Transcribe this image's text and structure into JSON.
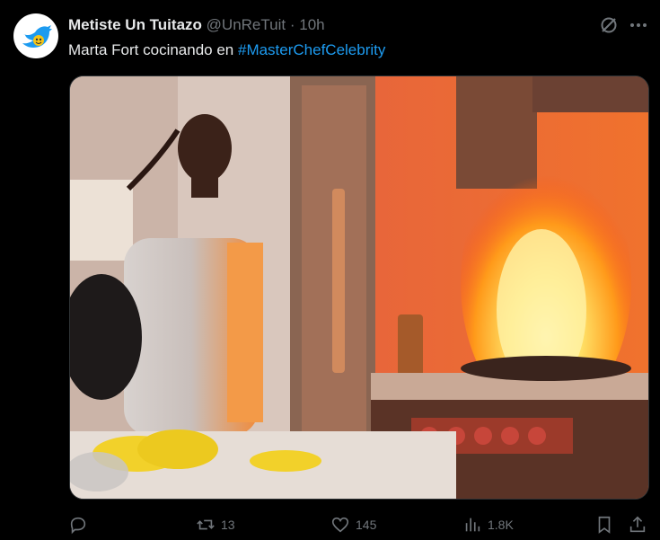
{
  "tweet": {
    "display_name": "Metiste Un Tuitazo",
    "handle": "@UnReTuit",
    "separator": "·",
    "time": "10h",
    "text_before": "Marta Fort cocinando en ",
    "hashtag": "#MasterChefCelebrity"
  },
  "actions": {
    "reply_count": "",
    "retweet_count": "13",
    "like_count": "145",
    "view_count": "1.8K"
  },
  "icons": [
    "grok-icon",
    "more-icon",
    "reply-icon",
    "retweet-icon",
    "like-icon",
    "views-icon",
    "bookmark-icon",
    "share-icon"
  ],
  "colors": {
    "link": "#1d9bf0",
    "muted": "#71767b",
    "text": "#e7e9ea"
  }
}
